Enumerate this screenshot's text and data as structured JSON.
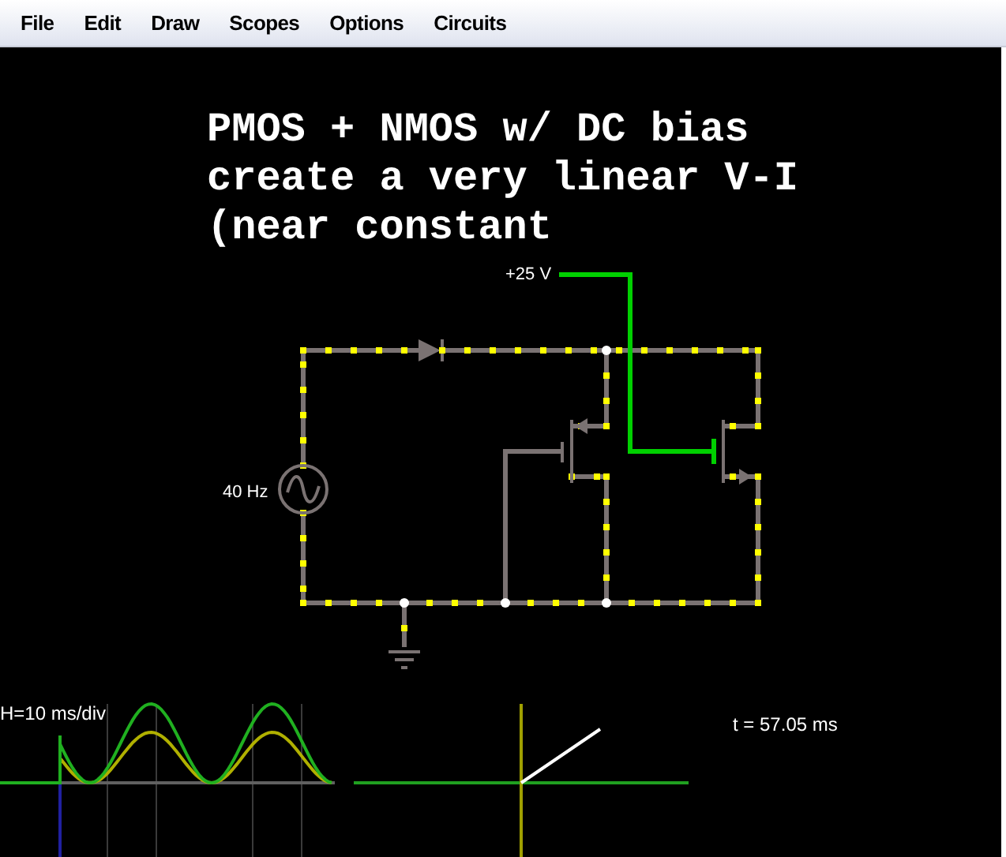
{
  "menu": [
    {
      "label": "File"
    },
    {
      "label": "Edit"
    },
    {
      "label": "Draw"
    },
    {
      "label": "Scopes"
    },
    {
      "label": "Options"
    },
    {
      "label": "Circuits"
    }
  ],
  "canvas_text": [
    "PMOS + NMOS w/ DC bias",
    "create a very linear V-I",
    "(near constant"
  ],
  "circuit": {
    "supply_label": "+25 V",
    "source_label": "40 Hz"
  },
  "scopes": {
    "scale_label": "H=10 ms/div",
    "time_label": "t = 57.05 ms"
  }
}
